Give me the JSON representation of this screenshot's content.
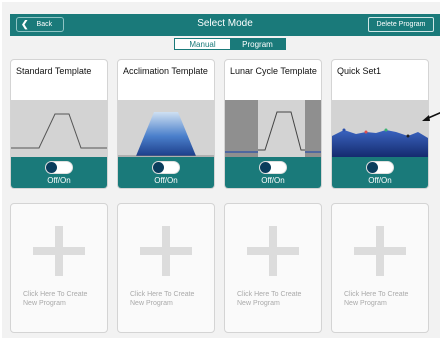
{
  "header": {
    "back_label": "Back",
    "title": "Select Mode",
    "delete_label": "Delete Program"
  },
  "mode_tabs": [
    {
      "label": "Manual",
      "selected": false
    },
    {
      "label": "Program",
      "selected": true
    }
  ],
  "programs": [
    {
      "name": "Standard Template",
      "toggle_label": "Off/On",
      "preview": "standard-curve"
    },
    {
      "name": "Acclimation Template",
      "toggle_label": "Off/On",
      "preview": "acclimation-curve"
    },
    {
      "name": "Lunar Cycle Template",
      "toggle_label": "Off/On",
      "preview": "lunar-curve"
    },
    {
      "name": "Quick Set1",
      "toggle_label": "Off/On",
      "preview": "quickset-curve"
    }
  ],
  "empty_slots": [
    {
      "line1": "Click Here To Create",
      "line2": "New Program"
    },
    {
      "line1": "Click Here To Create",
      "line2": "New Program"
    },
    {
      "line1": "Click Here To Create",
      "line2": "New Program"
    },
    {
      "line1": "Click Here To Create",
      "line2": "New Program"
    }
  ],
  "colors": {
    "header": "#1a7a7a",
    "background": "#f2f2f2",
    "preview_bg": "#d3d3d3",
    "knob": "#0a3d5c"
  }
}
